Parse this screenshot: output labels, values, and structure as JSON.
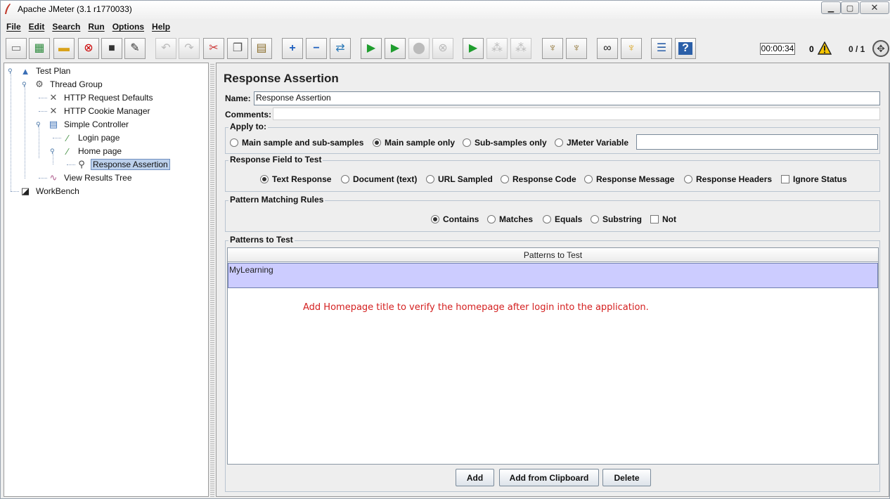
{
  "window": {
    "title": "Apache JMeter (3.1 r1770033)"
  },
  "menu": [
    "File",
    "Edit",
    "Search",
    "Run",
    "Options",
    "Help"
  ],
  "toolbar": {
    "timer": "00:00:34",
    "error_count": "0",
    "threads": "0 / 1"
  },
  "tree": {
    "nodes": [
      {
        "label": "Test Plan",
        "icon": "test-plan-icon"
      },
      {
        "label": "Thread Group",
        "icon": "gear-icon"
      },
      {
        "label": "HTTP Request Defaults",
        "icon": "tools-icon"
      },
      {
        "label": "HTTP Cookie Manager",
        "icon": "tools-icon"
      },
      {
        "label": "Simple Controller",
        "icon": "controller-icon"
      },
      {
        "label": "Login page",
        "icon": "pipette-icon"
      },
      {
        "label": "Home page",
        "icon": "pipette-icon"
      },
      {
        "label": "Response Assertion",
        "icon": "magnifier-icon"
      },
      {
        "label": "View Results Tree",
        "icon": "graph-icon"
      },
      {
        "label": "WorkBench",
        "icon": "workbench-icon"
      }
    ],
    "selected": "Response Assertion"
  },
  "panel": {
    "title": "Response Assertion",
    "name_label": "Name:",
    "name_value": "Response Assertion",
    "comments_label": "Comments:",
    "comments_value": "",
    "apply_to": {
      "title": "Apply to:",
      "options": [
        "Main sample and sub-samples",
        "Main sample only",
        "Sub-samples only",
        "JMeter Variable"
      ],
      "selected": "Main sample only",
      "variable_value": ""
    },
    "response_field": {
      "title": "Response Field to Test",
      "options": [
        "Text Response",
        "Document (text)",
        "URL Sampled",
        "Response Code",
        "Response Message",
        "Response Headers"
      ],
      "selected": "Text Response",
      "ignore_status_label": "Ignore Status",
      "ignore_status_checked": false
    },
    "pattern_rules": {
      "title": "Pattern Matching Rules",
      "options": [
        "Contains",
        "Matches",
        "Equals",
        "Substring"
      ],
      "selected": "Contains",
      "not_label": "Not",
      "not_checked": false
    },
    "patterns": {
      "title": "Patterns to Test",
      "column_header": "Patterns to Test",
      "rows": [
        "MyLearning"
      ],
      "annotation": "Add Homepage title to verify the homepage after login into the application."
    },
    "buttons": {
      "add": "Add",
      "add_clipboard": "Add from Clipboard",
      "delete": "Delete"
    }
  }
}
